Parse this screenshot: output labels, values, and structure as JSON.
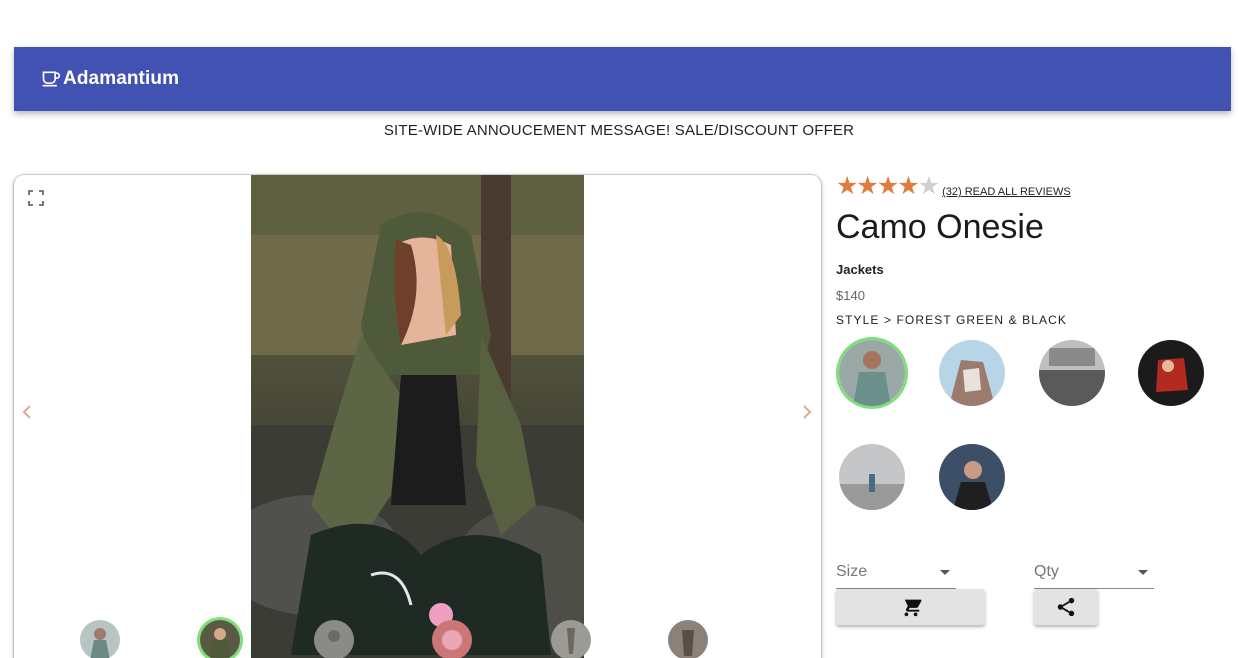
{
  "header": {
    "brand": "Adamantium",
    "brand_icon": "coffee-cup-icon",
    "bar_color": "#4152b3"
  },
  "announcement": "SITE-WIDE ANNOUCEMENT MESSAGE! SALE/DISCOUNT OFFER",
  "gallery": {
    "fullscreen_icon": "fullscreen-icon",
    "prev_icon": "chevron-left-icon",
    "next_icon": "chevron-right-icon",
    "thumbnails_count": 6,
    "active_thumbnail": 2
  },
  "product": {
    "rating": 4,
    "rating_max": 5,
    "reviews_link": "(32) READ ALL REVIEWS",
    "title": "Camo Onesie",
    "category": "Jackets",
    "price": "$140",
    "style_label": "STYLE > FOREST GREEN & BLACK",
    "styles_count": 6,
    "active_style": 1
  },
  "controls": {
    "size_label": "Size",
    "qty_label": "Qty",
    "cart_icon": "cart-icon",
    "share_icon": "share-icon"
  },
  "colors": {
    "accent_star": "#e27a3f",
    "selected_ring": "#7fe07a"
  }
}
